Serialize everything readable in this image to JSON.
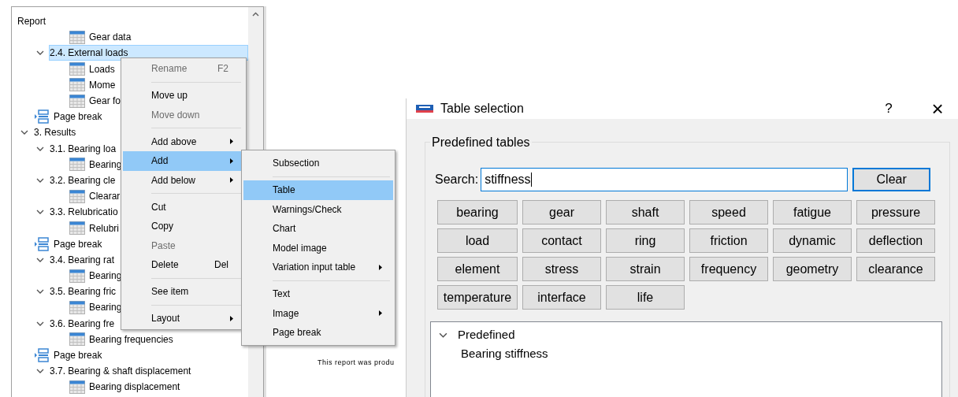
{
  "tree": {
    "header": "Report",
    "items": [
      {
        "children": [
          {
            "children": [
              {
                "kind": "table",
                "label": "Gear data",
                "selected": false
              }
            ]
          },
          {
            "kind": "section",
            "label": "2.4. External loads",
            "expanded": true,
            "selected": true,
            "children": [
              {
                "kind": "table",
                "label": "Loads",
                "selected": false
              },
              {
                "kind": "table",
                "label": "Mome",
                "selected": false
              },
              {
                "kind": "table",
                "label": "Gear fo",
                "selected": false
              }
            ]
          },
          {
            "kind": "page_break",
            "label": "Page break",
            "selected": false
          }
        ]
      },
      {
        "kind": "section",
        "label": "3. Results",
        "expanded": true,
        "selected": false,
        "children": [
          {
            "kind": "section",
            "label": "3.1. Bearing loa",
            "expanded": true,
            "selected": false,
            "children": [
              {
                "kind": "table",
                "label": "Bearing",
                "selected": false
              }
            ]
          },
          {
            "kind": "section",
            "label": "3.2. Bearing cle",
            "expanded": true,
            "selected": false,
            "children": [
              {
                "kind": "table",
                "label": "Clearar",
                "selected": false
              }
            ]
          },
          {
            "kind": "section",
            "label": "3.3. Relubricatio",
            "expanded": true,
            "selected": false,
            "children": [
              {
                "kind": "table",
                "label": "Relubri",
                "selected": false
              }
            ]
          },
          {
            "kind": "page_break",
            "label": "Page break",
            "selected": false
          },
          {
            "kind": "section",
            "label": "3.4. Bearing rat",
            "expanded": true,
            "selected": false,
            "children": [
              {
                "kind": "table",
                "label": "Bearing",
                "selected": false
              }
            ]
          },
          {
            "kind": "section",
            "label": "3.5. Bearing fric",
            "expanded": true,
            "selected": false,
            "children": [
              {
                "kind": "table",
                "label": "Bearing",
                "selected": false
              }
            ]
          },
          {
            "kind": "section",
            "label": "3.6. Bearing fre",
            "expanded": true,
            "selected": false,
            "children": [
              {
                "kind": "table",
                "label": "Bearing frequencies",
                "selected": false
              }
            ]
          },
          {
            "kind": "page_break",
            "label": "Page break",
            "selected": false
          },
          {
            "kind": "section",
            "label": "3.7. Bearing & shaft displacement",
            "expanded": true,
            "selected": false,
            "children": [
              {
                "kind": "table",
                "label": "Bearing displacement",
                "selected": false
              }
            ]
          }
        ]
      }
    ]
  },
  "context_menu": {
    "items": [
      {
        "kind": "item",
        "label": "Rename",
        "shortcut": "F2",
        "disabled": true,
        "selected": false,
        "submenu": false
      },
      {
        "kind": "separator"
      },
      {
        "kind": "item",
        "label": "Move up",
        "disabled": false,
        "selected": false,
        "submenu": false
      },
      {
        "kind": "item",
        "label": "Move down",
        "disabled": true,
        "selected": false,
        "submenu": false
      },
      {
        "kind": "separator"
      },
      {
        "kind": "item",
        "label": "Add above",
        "disabled": false,
        "selected": false,
        "submenu": true
      },
      {
        "kind": "item",
        "label": "Add",
        "disabled": false,
        "selected": true,
        "submenu": true
      },
      {
        "kind": "item",
        "label": "Add below",
        "disabled": false,
        "selected": false,
        "submenu": true
      },
      {
        "kind": "separator"
      },
      {
        "kind": "item",
        "label": "Cut",
        "disabled": false,
        "selected": false,
        "submenu": false
      },
      {
        "kind": "item",
        "label": "Copy",
        "disabled": false,
        "selected": false,
        "submenu": false
      },
      {
        "kind": "item",
        "label": "Paste",
        "disabled": true,
        "selected": false,
        "submenu": false
      },
      {
        "kind": "item",
        "label": "Delete",
        "shortcut": "Del",
        "disabled": false,
        "selected": false,
        "submenu": false
      },
      {
        "kind": "separator"
      },
      {
        "kind": "item",
        "label": "See item",
        "disabled": false,
        "selected": false,
        "submenu": false
      },
      {
        "kind": "separator"
      },
      {
        "kind": "item",
        "label": "Layout",
        "disabled": false,
        "selected": false,
        "submenu": true
      }
    ]
  },
  "submenu": {
    "items": [
      {
        "kind": "item",
        "label": "Subsection",
        "disabled": false,
        "selected": false,
        "submenu": false
      },
      {
        "kind": "separator"
      },
      {
        "kind": "item",
        "label": "Table",
        "disabled": false,
        "selected": true,
        "submenu": false
      },
      {
        "kind": "item",
        "label": "Warnings/Check",
        "disabled": false,
        "selected": false,
        "submenu": false
      },
      {
        "kind": "item",
        "label": "Chart",
        "disabled": false,
        "selected": false,
        "submenu": false
      },
      {
        "kind": "item",
        "label": "Model image",
        "disabled": false,
        "selected": false,
        "submenu": false
      },
      {
        "kind": "item",
        "label": "Variation input table",
        "disabled": false,
        "selected": false,
        "submenu": true
      },
      {
        "kind": "separator"
      },
      {
        "kind": "item",
        "label": "Text",
        "disabled": false,
        "selected": false,
        "submenu": false
      },
      {
        "kind": "item",
        "label": "Image",
        "disabled": false,
        "selected": false,
        "submenu": true
      },
      {
        "kind": "item",
        "label": "Page break",
        "disabled": false,
        "selected": false,
        "submenu": false
      }
    ]
  },
  "report_page": {
    "footer_text": "This report was produ"
  },
  "dialog": {
    "title": "Table selection",
    "help": "?",
    "close": "×",
    "group_title": "Predefined tables",
    "search": {
      "label": "Search:",
      "value": "stiffness"
    },
    "clear_button": "Clear",
    "tags": [
      "bearing",
      "gear",
      "shaft",
      "speed",
      "fatigue",
      "pressure",
      "load",
      "contact",
      "ring",
      "friction",
      "dynamic",
      "deflection",
      "element",
      "stress",
      "strain",
      "frequency",
      "geometry",
      "clearance",
      "temperature",
      "interface",
      "life"
    ],
    "results": [
      {
        "label": "Predefined",
        "expanded": true,
        "children": [
          {
            "label": "Bearing stiffness"
          }
        ]
      }
    ]
  }
}
